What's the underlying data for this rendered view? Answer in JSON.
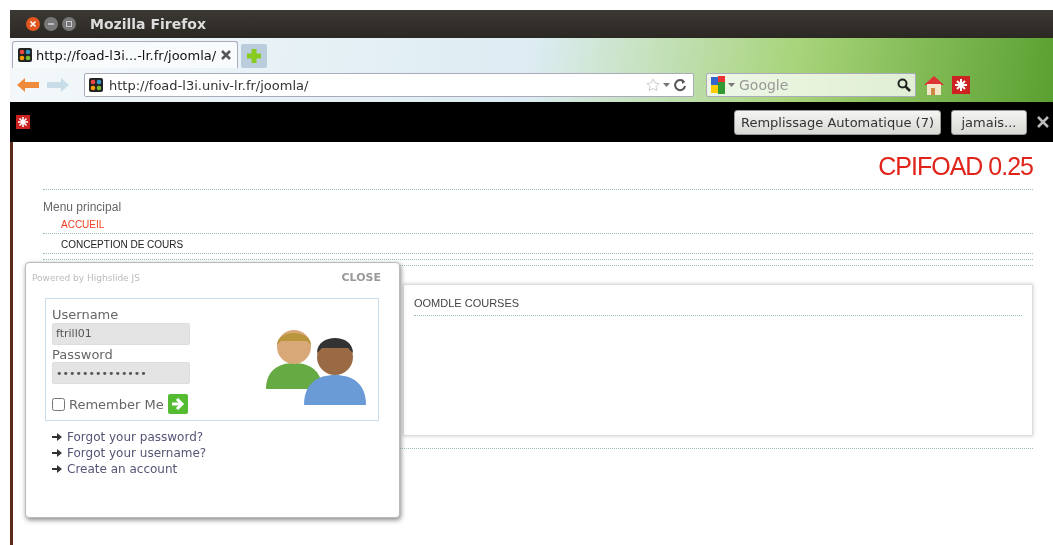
{
  "window": {
    "title": "Mozilla Firefox"
  },
  "tabs": [
    {
      "label": "http://foad-l3i...-lr.fr/joomla/",
      "selected": true
    }
  ],
  "address_bar": {
    "value": "http://foad-l3i.univ-lr.fr/joomla/"
  },
  "search": {
    "placeholder": "Google"
  },
  "notification_bar": {
    "buttons": [
      "Remplissage Automatique (7)",
      "jamais..."
    ]
  },
  "page": {
    "site_title": "CPIFOAD 0.25",
    "menu_title": "Menu principal",
    "menu_items": [
      {
        "label": "ACCUEIL",
        "selected": true
      },
      {
        "label": "CONCEPTION DE COURS",
        "selected": false
      }
    ],
    "card_title": "OOMDLE COURSES"
  },
  "login_popup": {
    "powered_by": "Powered by Highslide JS",
    "close": "CLOSE",
    "fields": [
      {
        "label": "Username",
        "value": "ftrill01"
      },
      {
        "label": "Password",
        "value": "••••••••••••••"
      }
    ],
    "remember": {
      "label": "Remember Me",
      "checked": false
    },
    "links": [
      "Forgot your password?",
      "Forgot your username?",
      "Create an account"
    ]
  }
}
